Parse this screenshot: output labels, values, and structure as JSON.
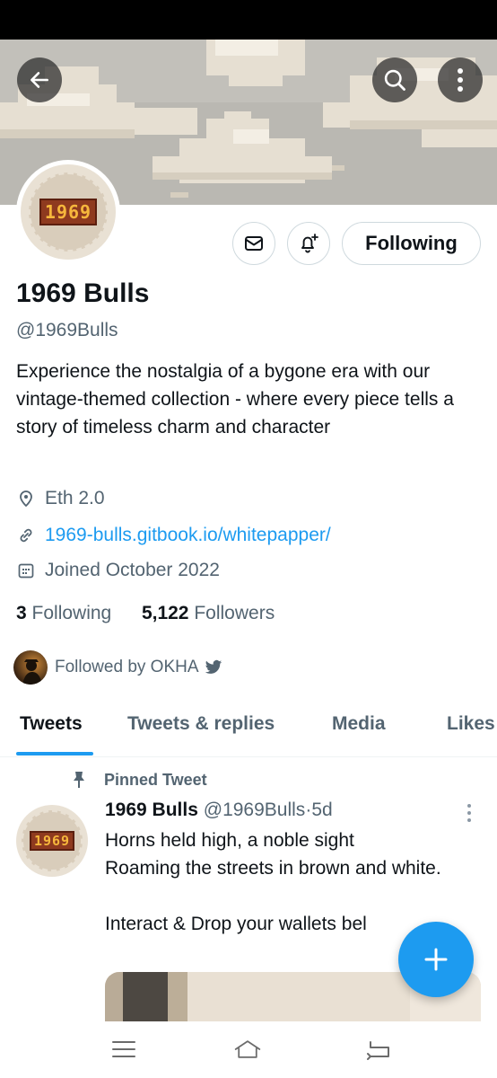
{
  "profile": {
    "name": "1969 Bulls",
    "handle": "@1969Bulls",
    "avatar_logo_text": "1969",
    "bio": "Experience the nostalgia of a bygone era with our vintage-themed collection - where every piece tells a story of timeless charm and character",
    "location": "Eth 2.0",
    "website": "1969-bulls.gitbook.io/whitepapper/",
    "joined": "Joined October 2022",
    "following_count": "3",
    "following_label": "Following",
    "followers_count": "5,122",
    "followers_label": "Followers",
    "followed_by": "Followed by OKHA"
  },
  "actions": {
    "following_button": "Following"
  },
  "tabs": [
    {
      "label": "Tweets",
      "active": true
    },
    {
      "label": "Tweets & replies",
      "active": false
    },
    {
      "label": "Media",
      "active": false
    },
    {
      "label": "Likes",
      "active": false
    }
  ],
  "pinned_tweet": {
    "pinned_label": "Pinned Tweet",
    "author_name": "1969 Bulls",
    "author_handle": "@1969Bulls",
    "separator": "·",
    "age": "5d",
    "text": "Horns held high, a noble sight\nRoaming the streets in brown and white.\n\nInteract & Drop your wallets bel"
  },
  "colors": {
    "accent": "#1d9bf0",
    "text_primary": "#0f1419",
    "text_secondary": "#536471",
    "status_bar": "#000000"
  },
  "icons": {
    "back": "arrow-left-icon",
    "search": "search-icon",
    "more": "more-vertical-icon",
    "message": "envelope-icon",
    "notify": "bell-plus-icon",
    "location": "location-pin-icon",
    "link": "link-icon",
    "calendar": "calendar-icon",
    "verified": "twitter-bird-icon",
    "pin": "pin-icon",
    "compose": "plus-icon",
    "nav_menu": "menu-icon",
    "nav_home": "home-icon",
    "nav_back": "back-icon"
  }
}
